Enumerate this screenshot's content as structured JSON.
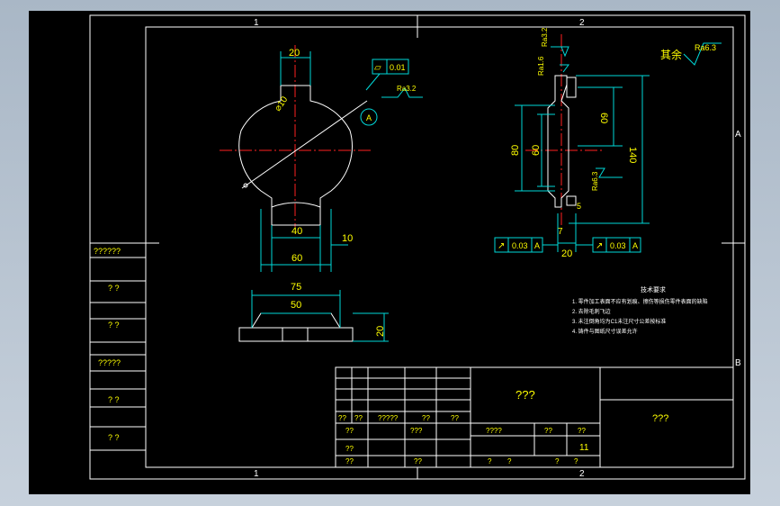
{
  "frame": {
    "zone_top_left": "1",
    "zone_top_right": "2",
    "zone_bottom_left": "1",
    "zone_bottom_right": "2",
    "zone_right_top": "A",
    "zone_right_bottom": "B"
  },
  "left_column": [
    "??????",
    "? ?",
    "? ?",
    "?????",
    "? ?",
    "? ?"
  ],
  "front_view": {
    "dim_top": "20",
    "dim_hole": "⌀10",
    "dim_40": "40",
    "dim_10": "10",
    "dim_60": "60",
    "flatness_value": "0.01",
    "roughness": "Ra3.2",
    "datum": "A"
  },
  "side_view": {
    "dim_80": "80",
    "dim_60": "60",
    "dim_60b": "60",
    "dim_140": "140",
    "dim_20": "20",
    "dim_7": "7",
    "dim_5": "5",
    "roughness_top": "Ra3.2",
    "roughness_left": "Ra1.6",
    "roughness_right": "Ra6.3",
    "general_roughness_label": "其余",
    "general_roughness_value": "Ra6.3",
    "tol_left_value": "0.03",
    "tol_left_datum": "A",
    "tol_right_value": "0.03",
    "tol_right_datum": "A"
  },
  "top_view": {
    "dim_75": "75",
    "dim_50": "50",
    "dim_20": "20"
  },
  "notes": {
    "title": "技术要求",
    "lines": [
      "1. 零件加工表面不应有划痕、擦伤等损伤零件表面的缺陷",
      "2. 去除毛刺飞边",
      "3. 未注倒角均为C1未注尺寸公差按标准",
      "4. 铸件与图纸尺寸误差允许"
    ]
  },
  "title_block": {
    "drawing_name": "???",
    "company": "???",
    "row_labels": [
      "??",
      "??",
      "?????",
      "??",
      "??"
    ],
    "left_labels": [
      "??",
      "??",
      "??"
    ],
    "mid_labels": [
      "???",
      "??"
    ],
    "scale_header": "????",
    "scale_header2": "??",
    "scale_header3": "??",
    "scale_value": "11",
    "bottom_labels": [
      "?",
      "?",
      "?",
      "?"
    ]
  }
}
